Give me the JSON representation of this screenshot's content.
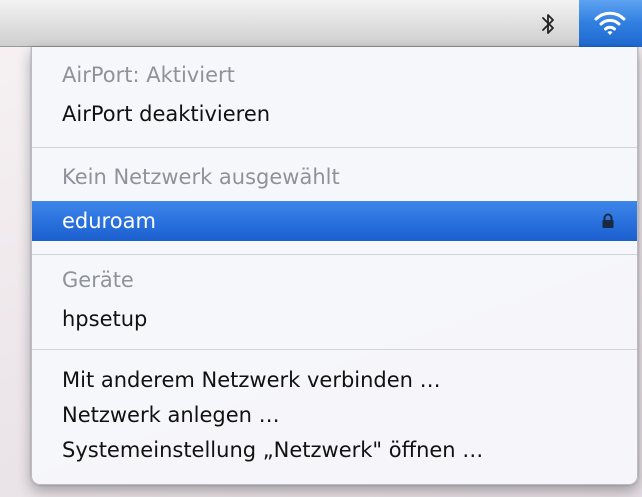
{
  "menubar": {
    "icons": [
      "bluetooth-icon",
      "wifi-icon"
    ],
    "accent": "#2f7fe0"
  },
  "menu": {
    "airport_status": "AirPort: Aktiviert",
    "airport_toggle": "AirPort deaktivieren",
    "network_header": "Kein Netzwerk ausgewählt",
    "networks": [
      {
        "name": "eduroam",
        "selected": true,
        "secured": true
      }
    ],
    "devices_header": "Geräte",
    "devices": [
      {
        "name": "hpsetup"
      }
    ],
    "actions": [
      "Mit anderem Netzwerk verbinden …",
      "Netzwerk anlegen …",
      "Systemeinstellung „Netzwerk\" öffnen …"
    ],
    "selection_color": "#2a72de"
  }
}
